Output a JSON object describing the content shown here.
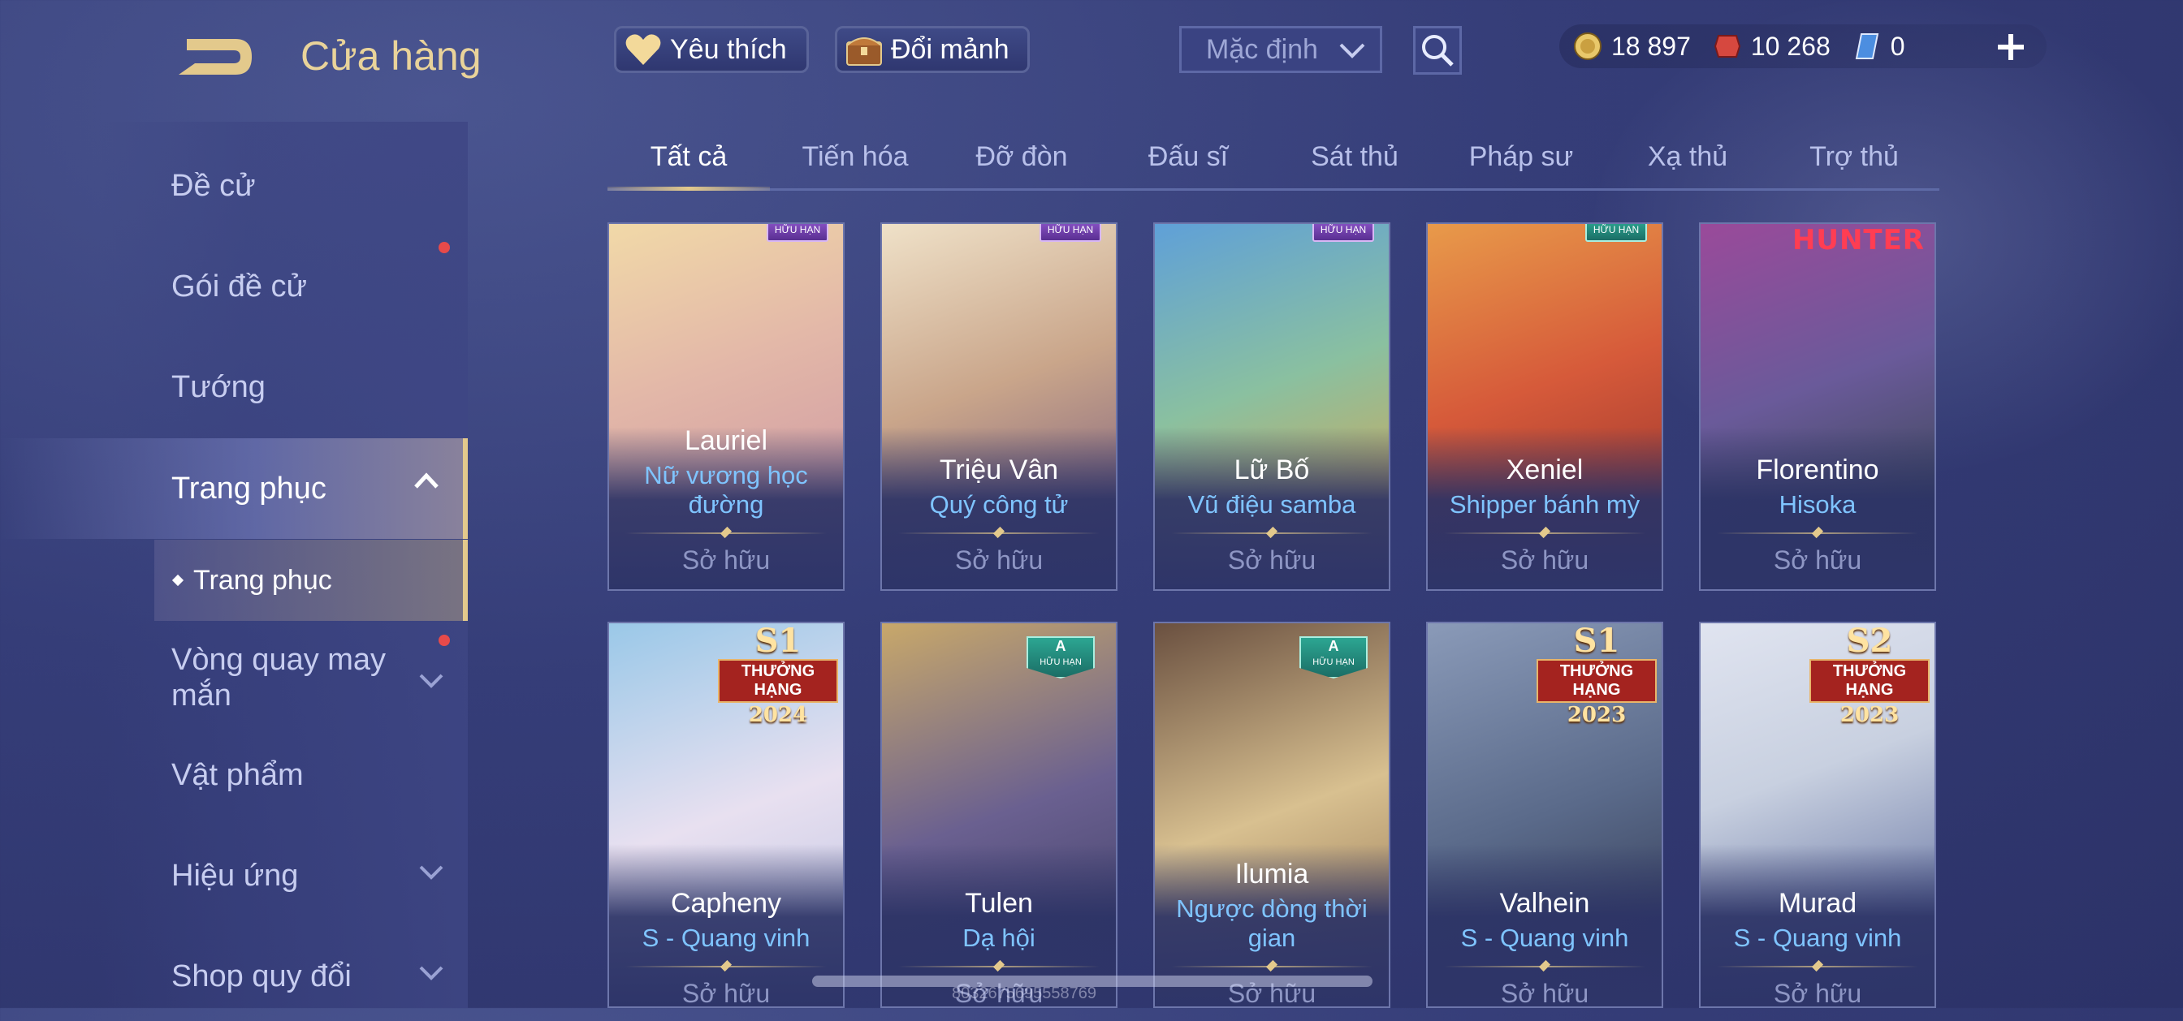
{
  "header": {
    "title": "Cửa hàng",
    "favorites_label": "Yêu thích",
    "exchange_label": "Đổi mảnh",
    "sort_select": "Mặc định",
    "currencies": [
      {
        "icon": "gold-coin-icon",
        "value": "18 897"
      },
      {
        "icon": "red-voucher-icon",
        "value": "10 268"
      },
      {
        "icon": "blue-voucher-icon",
        "value": "0"
      }
    ]
  },
  "sidebar": {
    "items": [
      {
        "label": "Đề cử"
      },
      {
        "label": "Gói đề cử"
      },
      {
        "label": "Tướng"
      },
      {
        "label": "Trang phục"
      },
      {
        "label": "Trang phục"
      },
      {
        "label": "Vòng quay may mắn"
      },
      {
        "label": "Vật phẩm"
      },
      {
        "label": "Hiệu ứng"
      },
      {
        "label": "Shop quy đổi"
      }
    ]
  },
  "tabs": [
    "Tất cả",
    "Tiến hóa",
    "Đỡ đòn",
    "Đấu sĩ",
    "Sát thủ",
    "Pháp sư",
    "Xạ thủ",
    "Trợ thủ"
  ],
  "cards": [
    {
      "hero": "Lauriel",
      "skin": "Nữ vương học đường",
      "status": "Sở hữu",
      "badge": "HỮU HẠN",
      "colors": [
        "#f1d9a8",
        "#c88fa0"
      ]
    },
    {
      "hero": "Triệu Vân",
      "skin": "Quý công tử",
      "status": "Sở hữu",
      "badge": "HỮU HẠN",
      "colors": [
        "#e6c7a4",
        "#6b4e7a"
      ]
    },
    {
      "hero": "Lữ Bố",
      "skin": "Vũ điệu samba",
      "status": "Sở hữu",
      "badge": "HỮU HẠN",
      "colors": [
        "#5fa0d8",
        "#e8a040"
      ]
    },
    {
      "hero": "Xeniel",
      "skin": "Shipper bánh mỳ",
      "status": "Sở hữu",
      "badge": "HỮU HẠN",
      "colors": [
        "#d65a3a",
        "#8a2a2a"
      ]
    },
    {
      "hero": "Florentino",
      "skin": "Hisoka",
      "status": "Sở hữu",
      "badge": "HUNTER",
      "colors": [
        "#9a4a9a",
        "#2a3f3a"
      ]
    },
    {
      "hero": "Capheny",
      "skin": "S - Quang vinh",
      "status": "Sở hữu",
      "badge_season": "S1",
      "badge_rank": "THƯỞNG HẠNG",
      "badge_year": "2024",
      "colors": [
        "#9ac8e8",
        "#d0c8e0"
      ]
    },
    {
      "hero": "Tulen",
      "skin": "Dạ hội",
      "status": "Sở hữu",
      "badge_a": "A",
      "badge": "HỮU HẠN",
      "colors": [
        "#c8a86a",
        "#3a3a60"
      ]
    },
    {
      "hero": "Ilumia",
      "skin": "Ngược dòng thời gian",
      "status": "Sở hữu",
      "badge_a": "A",
      "badge": "HỮU HẠN",
      "colors": [
        "#8a6a4a",
        "#d8c090"
      ]
    },
    {
      "hero": "Valhein",
      "skin": "S - Quang vinh",
      "status": "Sở hữu",
      "badge_season": "S1",
      "badge_rank": "THƯỞNG HẠNG",
      "badge_year": "2023",
      "colors": [
        "#5a6a8a",
        "#2a3048"
      ]
    },
    {
      "hero": "Murad",
      "skin": "S - Quang vinh",
      "status": "Sở hữu",
      "badge_season": "S2",
      "badge_rank": "THƯỞNG HẠNG",
      "badge_year": "2023",
      "colors": [
        "#c8d0e0",
        "#4a5a90"
      ]
    }
  ],
  "watermark": "8032675695558769"
}
